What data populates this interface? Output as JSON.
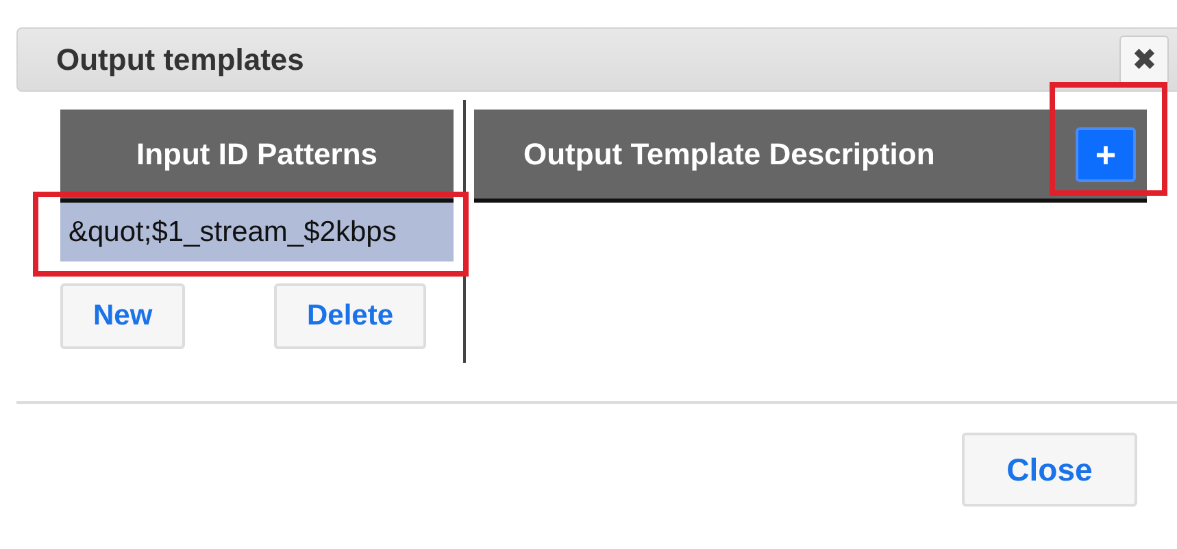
{
  "dialog": {
    "title": "Output templates",
    "close_icon": "✖"
  },
  "patterns": {
    "header": "Input ID Patterns",
    "rows": [
      {
        "text": "&quot;$1_stream_$2kbps",
        "selected": true,
        "highlighted": true
      }
    ],
    "buttons": [
      "New",
      "Delete"
    ]
  },
  "templates": {
    "header": "Output Template Description",
    "add_button": {
      "label": "+",
      "highlighted": true
    }
  },
  "footer": {
    "buttons": [
      "Close"
    ]
  }
}
